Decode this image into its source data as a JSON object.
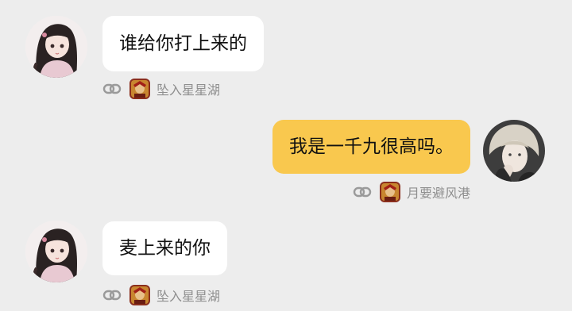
{
  "messages": [
    {
      "side": "left",
      "text": "谁给你打上来的",
      "hero_icon": "game-hero-icon",
      "username": "坠入星星湖",
      "avatar": "anime-girl-avatar"
    },
    {
      "side": "right",
      "text": "我是一千九很高吗。",
      "hero_icon": "game-hero-icon",
      "username": "月要避风港",
      "avatar": "blonde-person-avatar"
    },
    {
      "side": "left",
      "text": "麦上来的你",
      "hero_icon": "game-hero-icon",
      "username": "坠入星星湖",
      "avatar": "anime-girl-avatar"
    }
  ],
  "colors": {
    "background": "#ededed",
    "bubble_left": "#ffffff",
    "bubble_right": "#f9c84e",
    "meta_text": "#8f8f8f"
  }
}
